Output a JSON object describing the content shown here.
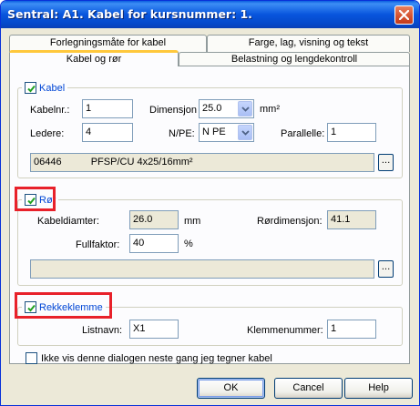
{
  "window": {
    "title": "Sentral: A1. Kabel for kursnummer: 1."
  },
  "tabs": [
    {
      "label": "Forlegningsmåte for kabel"
    },
    {
      "label": "Farge, lag, visning og tekst"
    },
    {
      "label": "Kabel og rør"
    },
    {
      "label": "Belastning og lengdekontroll"
    }
  ],
  "kabel": {
    "legend": "Kabel",
    "checked": true,
    "kabelnr_label": "Kabelnr.:",
    "kabelnr_value": "1",
    "dimensjon_label": "Dimensjon",
    "dimensjon_value": "25.0",
    "dimensjon_unit": "mm²",
    "ledere_label": "Ledere:",
    "ledere_value": "4",
    "npe_label": "N/PE:",
    "npe_value": "N PE",
    "parallelle_label": "Parallelle:",
    "parallelle_value": "1",
    "cable_code": "06446",
    "cable_desc": "PFSP/CU 4x25/16mm²",
    "browse_label": "..."
  },
  "ror": {
    "legend": "Rør",
    "checked": true,
    "kabeldiameter_label": "Kabeldiamter:",
    "kabeldiameter_value": "26.0",
    "kabeldiameter_unit": "mm",
    "rordimensjon_label": "Rørdimensjon:",
    "rordimensjon_value": "41.1",
    "fullfaktor_label": "Fullfaktor:",
    "fullfaktor_value": "40",
    "fullfaktor_unit": "%",
    "browse_label": "..."
  },
  "rekkeklemme": {
    "legend": "Rekkeklemme",
    "checked": true,
    "listnavn_label": "Listnavn:",
    "listnavn_value": "X1",
    "klemmenummer_label": "Klemmenummer:",
    "klemmenummer_value": "1"
  },
  "ikke_vis": {
    "label": "Ikke vis denne dialogen neste gang jeg tegner kabel",
    "checked": false
  },
  "buttons": {
    "ok": "OK",
    "cancel": "Cancel",
    "help": "Help"
  },
  "colors": {
    "highlight": "#e8212a",
    "legend_text": "#0046d5",
    "titlebar": "#0855dd"
  }
}
